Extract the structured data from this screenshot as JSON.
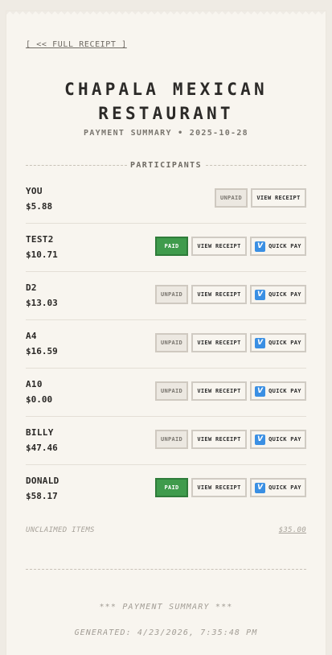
{
  "nav": {
    "full_receipt_label": "[ << FULL RECEIPT ]"
  },
  "header": {
    "title_line1": "CHAPALA MEXICAN",
    "title_line2": "RESTAURANT",
    "subtitle": "PAYMENT SUMMARY • 2025-10-28"
  },
  "section": {
    "participants_label": "PARTICIPANTS"
  },
  "participants": [
    {
      "name": "YOU",
      "amount": "$5.88",
      "status": "UNPAID",
      "view_label": "VIEW RECEIPT",
      "quick_pay_label": null
    },
    {
      "name": "TEST2",
      "amount": "$10.71",
      "status": "PAID",
      "view_label": "VIEW RECEIPT",
      "quick_pay_label": "QUICK PAY"
    },
    {
      "name": "D2",
      "amount": "$13.03",
      "status": "UNPAID",
      "view_label": "VIEW RECEIPT",
      "quick_pay_label": "QUICK PAY"
    },
    {
      "name": "A4",
      "amount": "$16.59",
      "status": "UNPAID",
      "view_label": "VIEW RECEIPT",
      "quick_pay_label": "QUICK PAY"
    },
    {
      "name": "A10",
      "amount": "$0.00",
      "status": "UNPAID",
      "view_label": "VIEW RECEIPT",
      "quick_pay_label": "QUICK PAY"
    },
    {
      "name": "BILLY",
      "amount": "$47.46",
      "status": "UNPAID",
      "view_label": "VIEW RECEIPT",
      "quick_pay_label": "QUICK PAY"
    },
    {
      "name": "DONALD",
      "amount": "$58.17",
      "status": "PAID",
      "view_label": "VIEW RECEIPT",
      "quick_pay_label": "QUICK PAY"
    }
  ],
  "unclaimed": {
    "label": "UNCLAIMED ITEMS",
    "amount": "$35.00"
  },
  "footer": {
    "summary": "*** PAYMENT SUMMARY ***",
    "generated": "GENERATED: 4/23/2026, 7:35:48 PM"
  },
  "icons": {
    "quick_pay": "venmo-icon"
  },
  "colors": {
    "paid": "#3f9b4c",
    "venmo": "#3a8fe3"
  }
}
